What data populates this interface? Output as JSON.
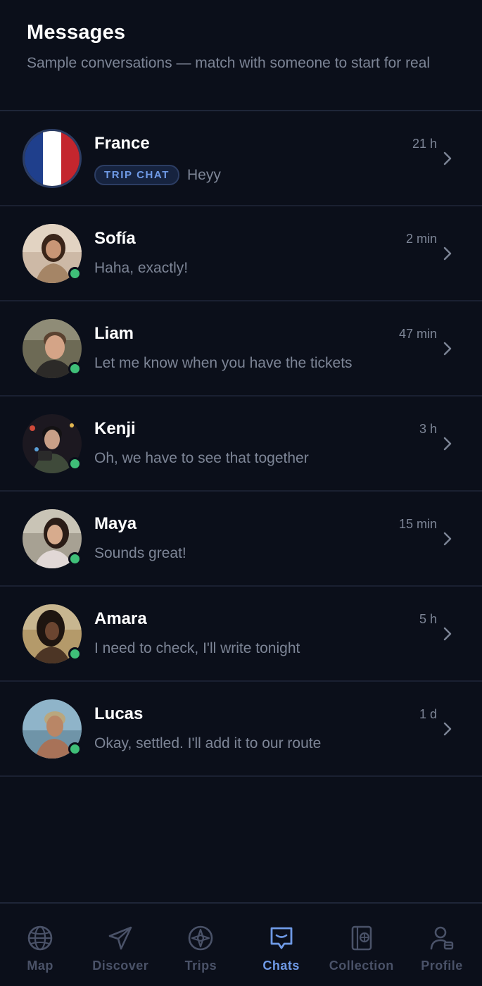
{
  "header": {
    "title": "Messages",
    "subtitle": "Sample conversations — match with someone to start for real"
  },
  "chats": [
    {
      "name": "France",
      "time": "21 h",
      "badge": "TRIP CHAT",
      "preview": "Heyy",
      "online": false
    },
    {
      "name": "Sofía",
      "time": "2 min",
      "preview": "Haha, exactly!",
      "online": true
    },
    {
      "name": "Liam",
      "time": "47 min",
      "preview": "Let me know when you have the tickets",
      "online": true
    },
    {
      "name": "Kenji",
      "time": "3 h",
      "preview": "Oh, we have to see that together",
      "online": true
    },
    {
      "name": "Maya",
      "time": "15 min",
      "preview": "Sounds great!",
      "online": true
    },
    {
      "name": "Amara",
      "time": "5 h",
      "preview": "I need to check, I'll write tonight",
      "online": true
    },
    {
      "name": "Lucas",
      "time": "1 d",
      "preview": "Okay, settled. I'll add it to our route",
      "online": true
    }
  ],
  "tabbar": {
    "tabs": [
      {
        "label": "Map",
        "icon": "globe-icon",
        "active": false
      },
      {
        "label": "Discover",
        "icon": "paper-plane-icon",
        "active": false
      },
      {
        "label": "Trips",
        "icon": "compass-icon",
        "active": false
      },
      {
        "label": "Chats",
        "icon": "chat-bubble-icon",
        "active": true
      },
      {
        "label": "Collection",
        "icon": "passport-icon",
        "active": false
      },
      {
        "label": "Profile",
        "icon": "profile-icon",
        "active": false
      }
    ]
  },
  "colors": {
    "background": "#0b0f1a",
    "accent": "#6f9ae6",
    "online": "#3fbf78",
    "muted_text": "#7d8596",
    "inactive_tab": "#4a5268"
  }
}
